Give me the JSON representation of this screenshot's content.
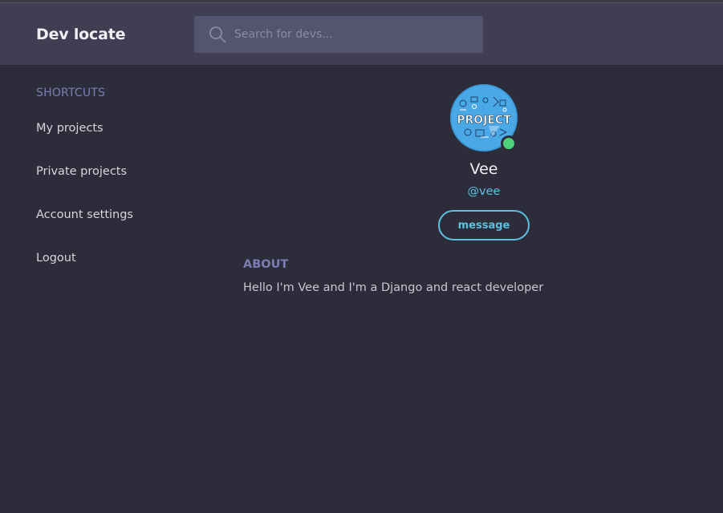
{
  "header": {
    "brand": "Dev locate",
    "search": {
      "placeholder": "Search for devs...",
      "value": ""
    }
  },
  "sidebar": {
    "heading": "SHORTCUTS",
    "items": [
      {
        "label": "My projects"
      },
      {
        "label": "Private projects"
      },
      {
        "label": "Account settings"
      },
      {
        "label": "Logout"
      }
    ]
  },
  "profile": {
    "avatar_text": "PROJECT",
    "online": true,
    "name": "Vee",
    "handle": "@vee",
    "message_label": "message"
  },
  "about": {
    "heading": "ABOUT",
    "text": "Hello I'm Vee and I'm a Django and react developer"
  },
  "colors": {
    "background": "#2d2c3a",
    "header": "#3f3e52",
    "search_bg": "#545470",
    "accent": "#5cc1de",
    "muted_heading": "#7d7db4",
    "online": "#4cd17a"
  }
}
